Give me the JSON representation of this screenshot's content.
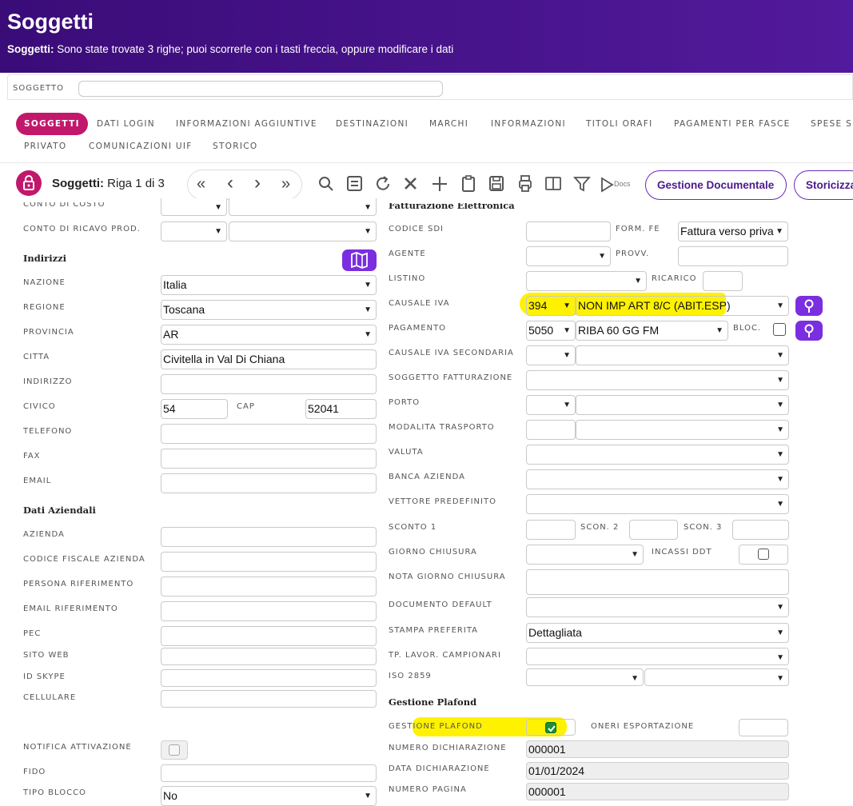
{
  "header": {
    "title": "Soggetti",
    "msg_prefix": "Soggetti:",
    "msg_text": " Sono state trovate 3 righe; puoi scorrerle con i tasti freccia, oppure modificare i dati"
  },
  "search": {
    "label": "SOGGETTO",
    "value": ""
  },
  "tabs": [
    "SOGGETTI",
    "DATI LOGIN",
    "INFORMAZIONI AGGIUNTIVE",
    "DESTINAZIONI",
    "MARCHI",
    "INFORMAZIONI",
    "TITOLI ORAFI",
    "PAGAMENTI PER FASCE",
    "SPESE SP",
    "PRIVATO",
    "COMUNICAZIONI UIF",
    "STORICO"
  ],
  "toolbar": {
    "record_label": "Soggetti:",
    "record_pos": " Riga 1 di 3",
    "first": "«",
    "prev": "‹",
    "next": "›",
    "last": "»",
    "docs_icon_text": "Docs",
    "btn_documentale": "Gestione Documentale",
    "btn_storicizza": "Storicizza"
  },
  "left": {
    "conto_costo_label": "CONTO DI COSTO",
    "conto_ricavo_label": "CONTO DI RICAVO PROD.",
    "section_indirizzi": "Indirizzi",
    "nazione_label": "NAZIONE",
    "nazione": "Italia",
    "regione_label": "REGIONE",
    "regione": "Toscana",
    "provincia_label": "PROVINCIA",
    "provincia": "AR",
    "citta_label": "CITTA",
    "citta": "Civitella in Val Di Chiana",
    "indirizzo_label": "INDIRIZZO",
    "indirizzo": "",
    "civico_label": "CIVICO",
    "civico": "54",
    "cap_label": "CAP",
    "cap": "52041",
    "telefono_label": "TELEFONO",
    "fax_label": "FAX",
    "email_label": "EMAIL",
    "section_aziendali": "Dati Aziendali",
    "azienda_label": "AZIENDA",
    "cf_azienda_label": "CODICE FISCALE AZIENDA",
    "persona_rif_label": "PERSONA RIFERIMENTO",
    "email_rif_label": "EMAIL RIFERIMENTO",
    "pec_label": "PEC",
    "sito_web_label": "SITO WEB",
    "id_skype_label": "ID SKYPE",
    "cellulare_label": "CELLULARE",
    "notifica_label": "NOTIFICA ATTIVAZIONE",
    "fido_label": "FIDO",
    "tipo_blocco_label": "TIPO BLOCCO",
    "tipo_blocco": "No"
  },
  "right": {
    "section_fatt": "Fatturazione Elettronica",
    "codice_sdi_label": "CODICE SDI",
    "form_fe_label": "FORM. FE",
    "form_fe": "Fattura verso priva",
    "agente_label": "AGENTE",
    "provv_label": "PROVV.",
    "listino_label": "LISTINO",
    "ricarico_label": "RICARICO",
    "causale_iva_label": "CAUSALE IVA",
    "causale_iva_code": "394",
    "causale_iva_desc": "NON IMP ART 8/C (ABIT.ESP)",
    "pagamento_label": "PAGAMENTO",
    "pagamento_code": "5050",
    "pagamento_desc": "RIBA 60 GG FM",
    "bloc_label": "BLOC.",
    "causale_iva_sec_label": "CAUSALE IVA SECONDARIA",
    "sogg_fatt_label": "SOGGETTO FATTURAZIONE",
    "porto_label": "PORTO",
    "modalita_label": "MODALITA TRASPORTO",
    "valuta_label": "VALUTA",
    "banca_label": "BANCA AZIENDA",
    "vettore_label": "VETTORE PREDEFINITO",
    "sconto1_label": "SCONTO 1",
    "scon2_label": "SCON. 2",
    "scon3_label": "SCON. 3",
    "giorno_chiusura_label": "GIORNO CHIUSURA",
    "incassi_label": "INCASSI DDT",
    "nota_giorno_label": "NOTA GIORNO CHIUSURA",
    "doc_default_label": "DOCUMENTO DEFAULT",
    "stampa_label": "STAMPA PREFERITA",
    "stampa": "Dettagliata",
    "tp_lavor_label": "TP. LAVOR. CAMPIONARI",
    "iso_label": "ISO 2859",
    "section_plafond": "Gestione Plafond",
    "gestione_plafond_label": "GESTIONE PLAFOND",
    "oneri_label": "ONERI ESPORTAZIONE",
    "num_dich_label": "NUMERO DICHIARAZIONE",
    "num_dich": "000001",
    "data_dich_label": "DATA DICHIARAZIONE",
    "data_dich": "01/01/2024",
    "num_pagina_label": "NUMERO PAGINA",
    "num_pagina": "000001"
  },
  "colors": {
    "header": "#3a0c78",
    "accent_tab": "#c2186b",
    "purple_button": "#7a2ee0",
    "highlight": "#fff200"
  }
}
